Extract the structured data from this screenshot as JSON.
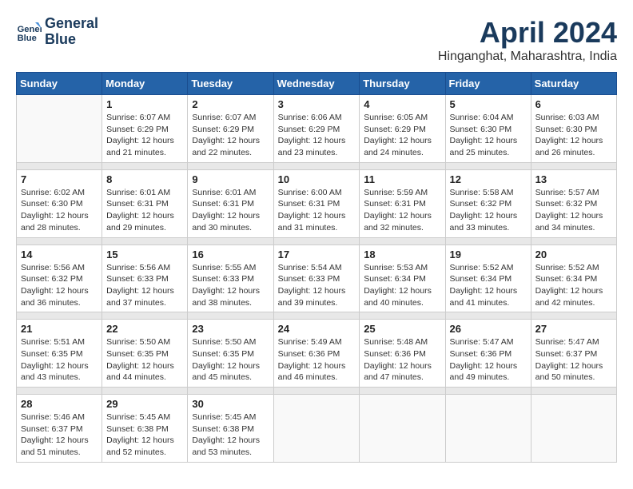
{
  "header": {
    "logo_line1": "General",
    "logo_line2": "Blue",
    "title": "April 2024",
    "subtitle": "Hinganghat, Maharashtra, India"
  },
  "columns": [
    "Sunday",
    "Monday",
    "Tuesday",
    "Wednesday",
    "Thursday",
    "Friday",
    "Saturday"
  ],
  "weeks": [
    [
      {
        "num": "",
        "info": ""
      },
      {
        "num": "1",
        "info": "Sunrise: 6:07 AM\nSunset: 6:29 PM\nDaylight: 12 hours\nand 21 minutes."
      },
      {
        "num": "2",
        "info": "Sunrise: 6:07 AM\nSunset: 6:29 PM\nDaylight: 12 hours\nand 22 minutes."
      },
      {
        "num": "3",
        "info": "Sunrise: 6:06 AM\nSunset: 6:29 PM\nDaylight: 12 hours\nand 23 minutes."
      },
      {
        "num": "4",
        "info": "Sunrise: 6:05 AM\nSunset: 6:29 PM\nDaylight: 12 hours\nand 24 minutes."
      },
      {
        "num": "5",
        "info": "Sunrise: 6:04 AM\nSunset: 6:30 PM\nDaylight: 12 hours\nand 25 minutes."
      },
      {
        "num": "6",
        "info": "Sunrise: 6:03 AM\nSunset: 6:30 PM\nDaylight: 12 hours\nand 26 minutes."
      }
    ],
    [
      {
        "num": "7",
        "info": "Sunrise: 6:02 AM\nSunset: 6:30 PM\nDaylight: 12 hours\nand 28 minutes."
      },
      {
        "num": "8",
        "info": "Sunrise: 6:01 AM\nSunset: 6:31 PM\nDaylight: 12 hours\nand 29 minutes."
      },
      {
        "num": "9",
        "info": "Sunrise: 6:01 AM\nSunset: 6:31 PM\nDaylight: 12 hours\nand 30 minutes."
      },
      {
        "num": "10",
        "info": "Sunrise: 6:00 AM\nSunset: 6:31 PM\nDaylight: 12 hours\nand 31 minutes."
      },
      {
        "num": "11",
        "info": "Sunrise: 5:59 AM\nSunset: 6:31 PM\nDaylight: 12 hours\nand 32 minutes."
      },
      {
        "num": "12",
        "info": "Sunrise: 5:58 AM\nSunset: 6:32 PM\nDaylight: 12 hours\nand 33 minutes."
      },
      {
        "num": "13",
        "info": "Sunrise: 5:57 AM\nSunset: 6:32 PM\nDaylight: 12 hours\nand 34 minutes."
      }
    ],
    [
      {
        "num": "14",
        "info": "Sunrise: 5:56 AM\nSunset: 6:32 PM\nDaylight: 12 hours\nand 36 minutes."
      },
      {
        "num": "15",
        "info": "Sunrise: 5:56 AM\nSunset: 6:33 PM\nDaylight: 12 hours\nand 37 minutes."
      },
      {
        "num": "16",
        "info": "Sunrise: 5:55 AM\nSunset: 6:33 PM\nDaylight: 12 hours\nand 38 minutes."
      },
      {
        "num": "17",
        "info": "Sunrise: 5:54 AM\nSunset: 6:33 PM\nDaylight: 12 hours\nand 39 minutes."
      },
      {
        "num": "18",
        "info": "Sunrise: 5:53 AM\nSunset: 6:34 PM\nDaylight: 12 hours\nand 40 minutes."
      },
      {
        "num": "19",
        "info": "Sunrise: 5:52 AM\nSunset: 6:34 PM\nDaylight: 12 hours\nand 41 minutes."
      },
      {
        "num": "20",
        "info": "Sunrise: 5:52 AM\nSunset: 6:34 PM\nDaylight: 12 hours\nand 42 minutes."
      }
    ],
    [
      {
        "num": "21",
        "info": "Sunrise: 5:51 AM\nSunset: 6:35 PM\nDaylight: 12 hours\nand 43 minutes."
      },
      {
        "num": "22",
        "info": "Sunrise: 5:50 AM\nSunset: 6:35 PM\nDaylight: 12 hours\nand 44 minutes."
      },
      {
        "num": "23",
        "info": "Sunrise: 5:50 AM\nSunset: 6:35 PM\nDaylight: 12 hours\nand 45 minutes."
      },
      {
        "num": "24",
        "info": "Sunrise: 5:49 AM\nSunset: 6:36 PM\nDaylight: 12 hours\nand 46 minutes."
      },
      {
        "num": "25",
        "info": "Sunrise: 5:48 AM\nSunset: 6:36 PM\nDaylight: 12 hours\nand 47 minutes."
      },
      {
        "num": "26",
        "info": "Sunrise: 5:47 AM\nSunset: 6:36 PM\nDaylight: 12 hours\nand 49 minutes."
      },
      {
        "num": "27",
        "info": "Sunrise: 5:47 AM\nSunset: 6:37 PM\nDaylight: 12 hours\nand 50 minutes."
      }
    ],
    [
      {
        "num": "28",
        "info": "Sunrise: 5:46 AM\nSunset: 6:37 PM\nDaylight: 12 hours\nand 51 minutes."
      },
      {
        "num": "29",
        "info": "Sunrise: 5:45 AM\nSunset: 6:38 PM\nDaylight: 12 hours\nand 52 minutes."
      },
      {
        "num": "30",
        "info": "Sunrise: 5:45 AM\nSunset: 6:38 PM\nDaylight: 12 hours\nand 53 minutes."
      },
      {
        "num": "",
        "info": ""
      },
      {
        "num": "",
        "info": ""
      },
      {
        "num": "",
        "info": ""
      },
      {
        "num": "",
        "info": ""
      }
    ]
  ]
}
